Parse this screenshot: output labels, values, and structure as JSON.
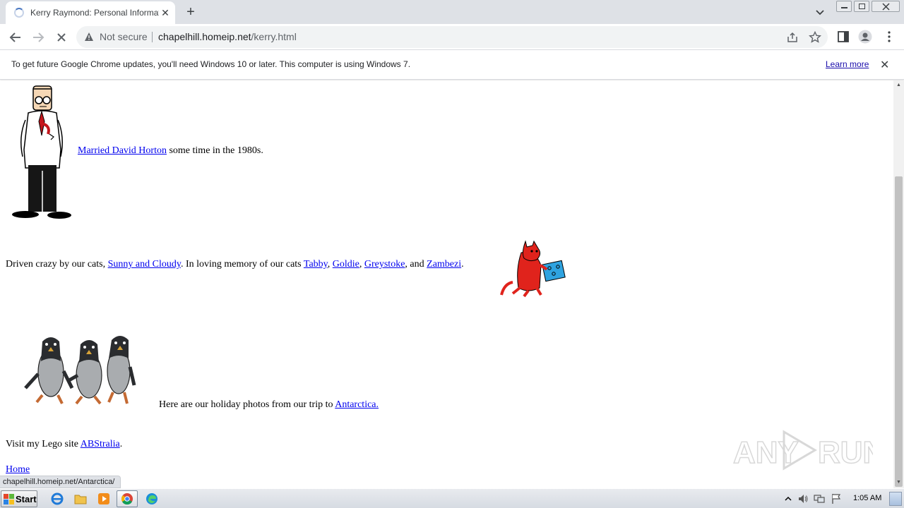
{
  "browser": {
    "tab_title": "Kerry Raymond: Personal Information",
    "new_tab_label": "+",
    "tab_close_label": "✕",
    "security_label": "Not secure",
    "url_host": "chapelhill.homeip.net",
    "url_path": "/kerry.html"
  },
  "infobar": {
    "message": "To get future Google Chrome updates, you'll need Windows 10 or later. This computer is using Windows 7.",
    "learn_more": "Learn more",
    "close_label": "✕"
  },
  "page": {
    "marriage": {
      "link": "Married David Horton",
      "text": " some time in the 1980s."
    },
    "cats": {
      "prefix": "Driven crazy by our cats, ",
      "current_cats_link": "Sunny and Cloudy",
      "middle": ". In loving memory of our cats ",
      "cat1": "Tabby",
      "sep1": ", ",
      "cat2": "Goldie",
      "sep2": ", ",
      "cat3": "Greystoke",
      "sep3": ", and ",
      "cat4": "Zambezi",
      "suffix": "."
    },
    "holiday": {
      "text": "Here are our holiday photos from our trip to ",
      "link": "Antarctica."
    },
    "lego": {
      "text": "Visit my Lego site ",
      "link": "ABStralia",
      "suffix": "."
    },
    "home_link": "Home"
  },
  "status_url": "chapelhill.homeip.net/Antarctica/",
  "watermark": "ANY RUN",
  "taskbar": {
    "start_label": "Start",
    "clock": "1:05 AM"
  },
  "colors": {
    "link": "#0000ee",
    "chrome_frame": "#dee1e6",
    "cat": "#e0231c",
    "gift_box": "#2fa3e0"
  }
}
